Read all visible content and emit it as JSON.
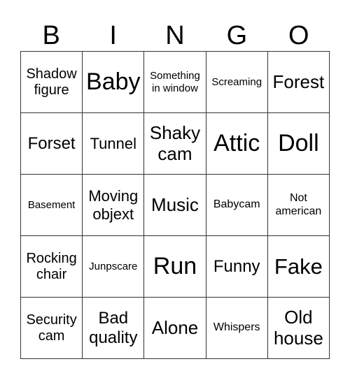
{
  "header": {
    "letters": [
      "B",
      "I",
      "N",
      "G",
      "O"
    ]
  },
  "board": {
    "rows": [
      [
        "Shadow figure",
        "Baby",
        "Something in window",
        "Screaming",
        "Forest"
      ],
      [
        "Forset",
        "Tunnel",
        "Shaky cam",
        "Attic",
        "Doll"
      ],
      [
        "Basement",
        "Moving objext",
        "Music",
        "Babycam",
        "Not american"
      ],
      [
        "Rocking chair",
        "Junpscare",
        "Run",
        "Funny",
        "Fake"
      ],
      [
        "Security cam",
        "Bad quality",
        "Alone",
        "Whispers",
        "Old house"
      ]
    ]
  }
}
